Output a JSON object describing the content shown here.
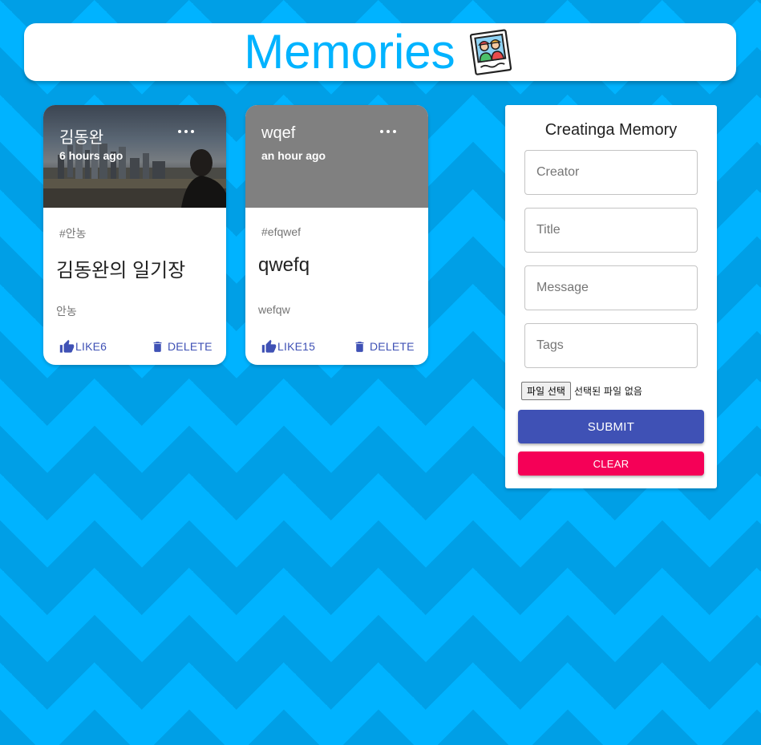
{
  "app": {
    "title": "Memories",
    "logo_icon": "memories-photo-icon",
    "accent_color": "#00b3ff"
  },
  "posts": [
    {
      "creator": "김동완",
      "time": "6 hours ago",
      "tags": "#안농",
      "title": "김동완의 일기장",
      "message": "안농",
      "like_label": "LIKE6",
      "delete_label": "DELETE",
      "media": "city-photo"
    },
    {
      "creator": "wqef",
      "time": "an hour ago",
      "tags": "#efqwef",
      "title": "qwefq",
      "message": "wefqw",
      "like_label": "LIKE15",
      "delete_label": "DELETE",
      "media": "gray-placeholder"
    }
  ],
  "form": {
    "heading": "Creatinga Memory",
    "creator_placeholder": "Creator",
    "title_placeholder": "Title",
    "message_placeholder": "Message",
    "tags_placeholder": "Tags",
    "file_button": "파일 선택",
    "file_status": "선택된 파일 없음",
    "submit_label": "SUBMIT",
    "clear_label": "CLEAR",
    "submit_color": "#3f51b5",
    "clear_color": "#f50057"
  }
}
